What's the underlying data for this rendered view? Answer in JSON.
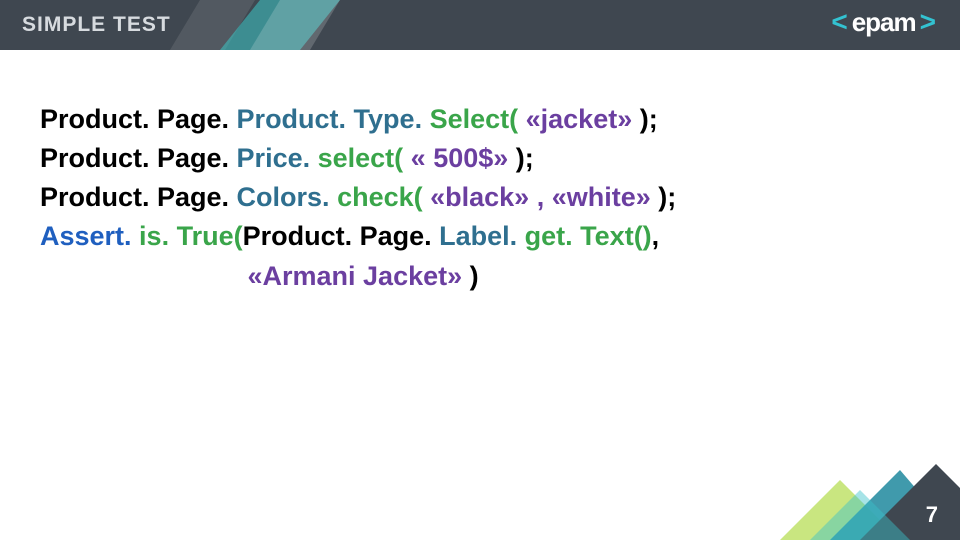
{
  "header": {
    "title": "SIMPLE TEST"
  },
  "logo": {
    "open": "<",
    "word": "epam",
    "close": ">"
  },
  "code": {
    "l1": {
      "a": "Product. Page.",
      "b": " Product. Type.",
      "c": " Select(",
      "d": " «jacket» ",
      "e": ");"
    },
    "l2": {
      "a": "Product. Page.",
      "b": " Price.",
      "c": " select(",
      "d": " « 500$» ",
      "e": ");"
    },
    "l3": {
      "a": "Product. Page.",
      "b": " Colors.",
      "c": " check(",
      "d": " «black» , «white» ",
      "e": ");"
    },
    "l4": {
      "a": "Assert.",
      "b": " is. True(",
      "c": "Product. Page.",
      "d": " Label.",
      "e": " get. Text()",
      "f": ","
    },
    "l5": {
      "a": " «Armani Jacket» ",
      "b": ")"
    }
  },
  "page_number": "7"
}
